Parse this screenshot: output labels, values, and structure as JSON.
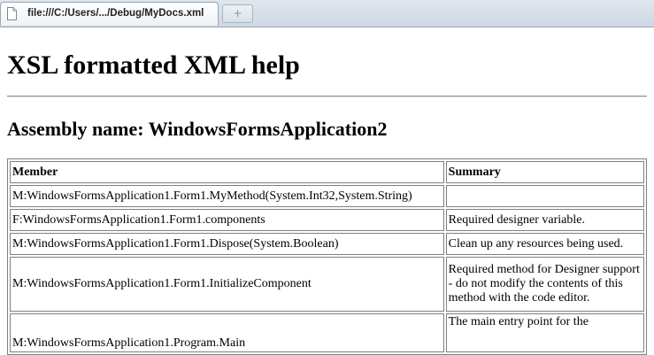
{
  "browser": {
    "tab_title": "file:///C:/Users/.../Debug/MyDocs.xml",
    "new_tab_glyph": "+"
  },
  "page": {
    "title": "XSL formatted XML help",
    "assembly_heading": "Assembly name: WindowsFormsApplication2"
  },
  "table": {
    "headers": [
      "Member",
      "Summary"
    ],
    "rows": [
      {
        "member": "M:WindowsFormsApplication1.Form1.MyMethod(System.Int32,System.String)",
        "summary": ""
      },
      {
        "member": "F:WindowsFormsApplication1.Form1.components",
        "summary": "Required designer variable."
      },
      {
        "member": "M:WindowsFormsApplication1.Form1.Dispose(System.Boolean)",
        "summary": "Clean up any resources being used."
      },
      {
        "member": "M:WindowsFormsApplication1.Form1.InitializeComponent",
        "summary": "Required method for Designer support - do not modify the contents of this method with the code editor."
      },
      {
        "member": "M:WindowsFormsApplication1.Program.Main",
        "summary": "The main entry point for the"
      }
    ]
  },
  "icons": {
    "tab_icon": "document-icon"
  }
}
